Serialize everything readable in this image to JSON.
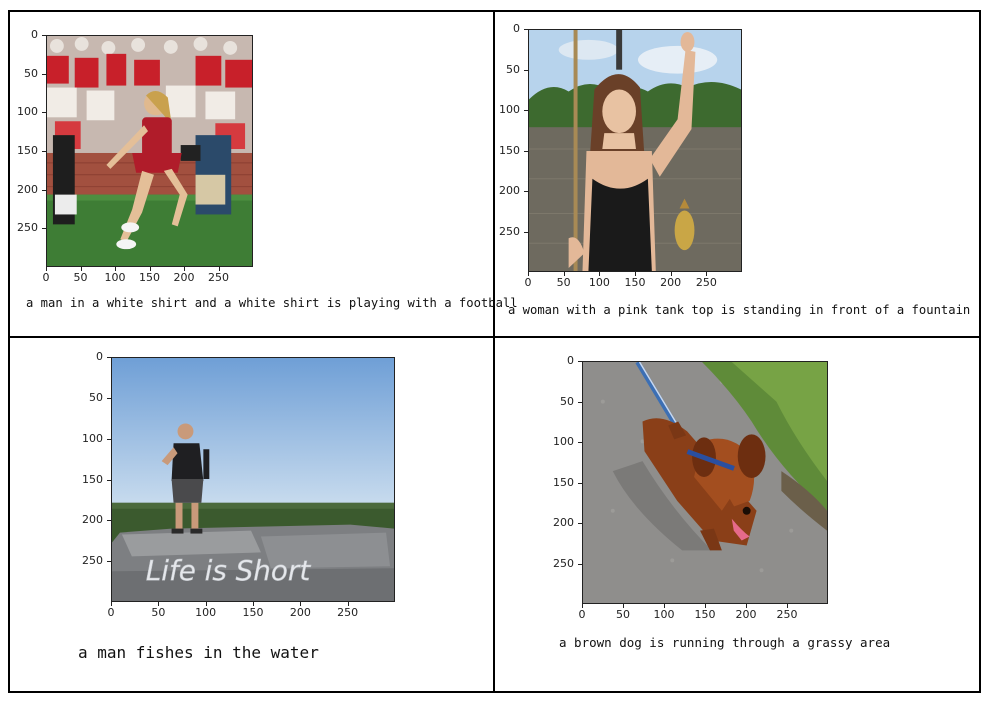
{
  "panels": [
    {
      "caption": "a man in a white shirt and a white shirt is playing with a football",
      "image": "cheerleader-at-football-stadium",
      "y_ticks": [
        "0",
        "50",
        "100",
        "150",
        "200",
        "250"
      ],
      "x_ticks": [
        "0",
        "50",
        "100",
        "150",
        "200",
        "250"
      ]
    },
    {
      "caption": "a woman with a pink tank top is standing in front of a fountain",
      "image": "woman-holding-fish-by-river",
      "y_ticks": [
        "0",
        "50",
        "100",
        "150",
        "200",
        "250"
      ],
      "x_ticks": [
        "0",
        "50",
        "100",
        "150",
        "200",
        "250"
      ]
    },
    {
      "caption": "a man fishes in the water",
      "image": "man-standing-on-rock-life-is-short",
      "rock_text": "Life is Short",
      "y_ticks": [
        "0",
        "50",
        "100",
        "150",
        "200",
        "250"
      ],
      "x_ticks": [
        "0",
        "50",
        "100",
        "150",
        "200",
        "250"
      ]
    },
    {
      "caption": "a brown dog is running through a grassy area",
      "image": "dachshund-walking-on-path",
      "y_ticks": [
        "0",
        "50",
        "100",
        "150",
        "200",
        "250"
      ],
      "x_ticks": [
        "0",
        "50",
        "100",
        "150",
        "200",
        "250"
      ]
    }
  ]
}
